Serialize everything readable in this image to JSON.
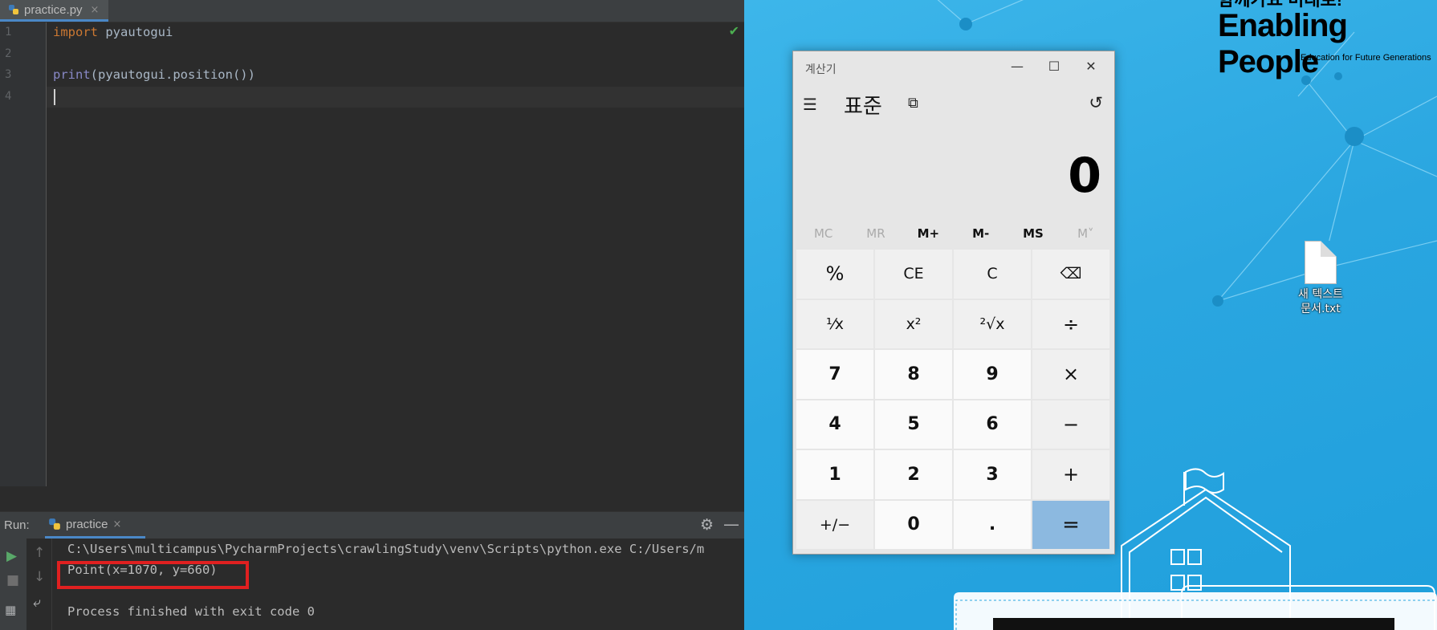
{
  "ide": {
    "tab": {
      "filename": "practice.py",
      "close": "×"
    },
    "line_numbers": [
      "1",
      "2",
      "3",
      "4"
    ],
    "code": {
      "line1_kw": "import",
      "line1_rest": " pyautogui",
      "line3_fn": "print",
      "line3_rest": "(pyautogui.position())"
    },
    "run": {
      "label": "Run:",
      "config": "practice",
      "console_lines": [
        "C:\\Users\\multicampus\\PycharmProjects\\crawlingStudy\\venv\\Scripts\\python.exe C:/Users/m",
        "Point(x=1070, y=660)",
        "",
        "Process finished with exit code 0"
      ]
    }
  },
  "desktop": {
    "brand_line1": "함께가요 미래로!",
    "brand_line2": "Enabling People",
    "brand_line3": "Education for Future Generations",
    "file_icon_label_line1": "새 텍스트",
    "file_icon_label_line2": "문서.txt"
  },
  "calculator": {
    "title": "계산기",
    "mode": "표준",
    "display": "0",
    "memory": [
      "MC",
      "MR",
      "M+",
      "M-",
      "MS",
      "M˅"
    ],
    "keys": [
      {
        "label": "%",
        "kind": "op"
      },
      {
        "label": "CE",
        "kind": "fn"
      },
      {
        "label": "C",
        "kind": "fn"
      },
      {
        "label": "⌫",
        "kind": "fn"
      },
      {
        "label": "¹⁄x",
        "kind": "fn"
      },
      {
        "label": "x²",
        "kind": "fn"
      },
      {
        "label": "²√x",
        "kind": "fn"
      },
      {
        "label": "÷",
        "kind": "op"
      },
      {
        "label": "7",
        "kind": "num"
      },
      {
        "label": "8",
        "kind": "num"
      },
      {
        "label": "9",
        "kind": "num"
      },
      {
        "label": "×",
        "kind": "op"
      },
      {
        "label": "4",
        "kind": "num"
      },
      {
        "label": "5",
        "kind": "num"
      },
      {
        "label": "6",
        "kind": "num"
      },
      {
        "label": "−",
        "kind": "op"
      },
      {
        "label": "1",
        "kind": "num"
      },
      {
        "label": "2",
        "kind": "num"
      },
      {
        "label": "3",
        "kind": "num"
      },
      {
        "label": "+",
        "kind": "op"
      },
      {
        "label": "+/−",
        "kind": "fn"
      },
      {
        "label": "0",
        "kind": "num"
      },
      {
        "label": ".",
        "kind": "num"
      },
      {
        "label": "=",
        "kind": "eq"
      }
    ]
  }
}
